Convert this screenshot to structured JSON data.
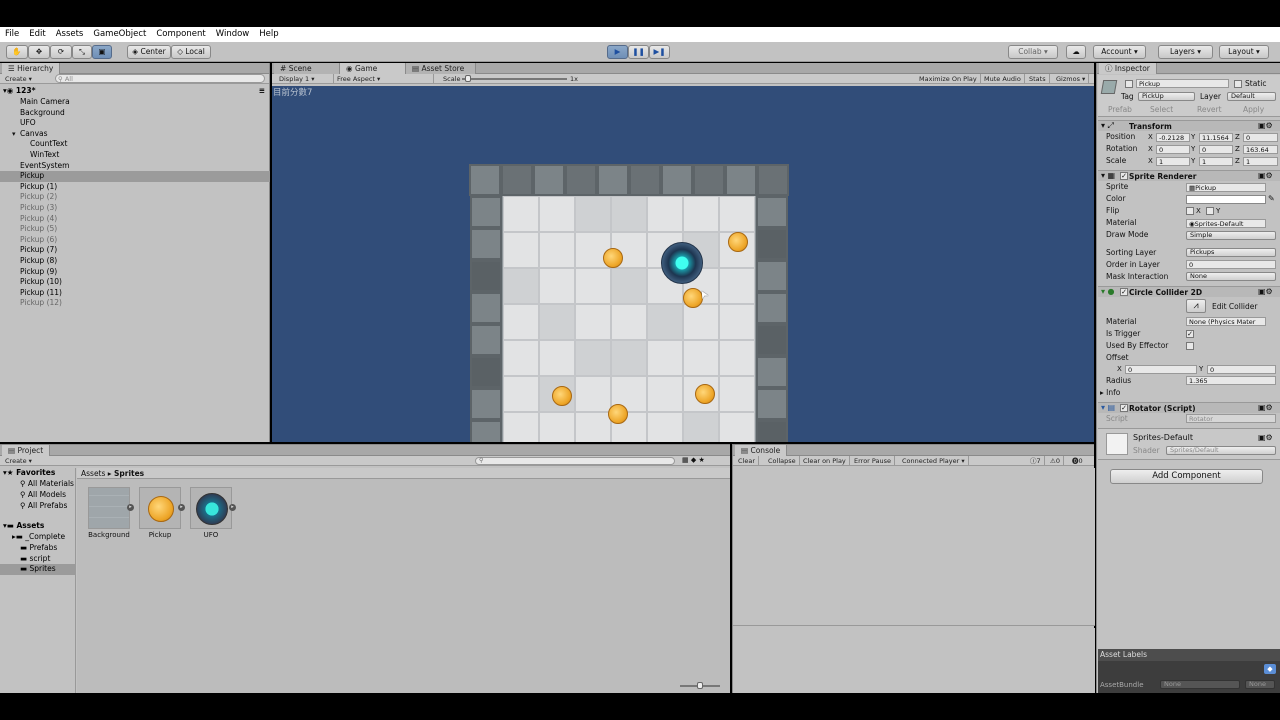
{
  "menu": [
    "File",
    "Edit",
    "Assets",
    "GameObject",
    "Component",
    "Window",
    "Help"
  ],
  "toolbar": {
    "center_label": "Center",
    "local_label": "Local",
    "collab_label": "Collab",
    "account_label": "Account",
    "layers_label": "Layers",
    "layout_label": "Layout"
  },
  "hierarchy": {
    "tab": "Hierarchy",
    "create": "Create",
    "search_placeholder": "All",
    "scene": "123*",
    "items": [
      {
        "label": "Main Camera",
        "state": "normal",
        "indent": 1
      },
      {
        "label": "Background",
        "state": "normal",
        "indent": 1
      },
      {
        "label": "UFO",
        "state": "normal",
        "indent": 1
      },
      {
        "label": "Canvas",
        "state": "normal",
        "indent": 1
      },
      {
        "label": "CountText",
        "state": "normal",
        "indent": 2
      },
      {
        "label": "WinText",
        "state": "normal",
        "indent": 2
      },
      {
        "label": "EventSystem",
        "state": "normal",
        "indent": 1
      },
      {
        "label": "Pickup",
        "state": "selected",
        "indent": 1
      },
      {
        "label": "Pickup (1)",
        "state": "normal",
        "indent": 1
      },
      {
        "label": "Pickup (2)",
        "state": "dim",
        "indent": 1
      },
      {
        "label": "Pickup (3)",
        "state": "dim",
        "indent": 1
      },
      {
        "label": "Pickup (4)",
        "state": "dim",
        "indent": 1
      },
      {
        "label": "Pickup (5)",
        "state": "dim",
        "indent": 1
      },
      {
        "label": "Pickup (6)",
        "state": "dim",
        "indent": 1
      },
      {
        "label": "Pickup (7)",
        "state": "normal",
        "indent": 1
      },
      {
        "label": "Pickup (8)",
        "state": "normal",
        "indent": 1
      },
      {
        "label": "Pickup (9)",
        "state": "normal",
        "indent": 1
      },
      {
        "label": "Pickup (10)",
        "state": "normal",
        "indent": 1
      },
      {
        "label": "Pickup (11)",
        "state": "normal",
        "indent": 1
      },
      {
        "label": "Pickup (12)",
        "state": "dim",
        "indent": 1
      }
    ]
  },
  "center_tabs": [
    "Scene",
    "Game",
    "Asset Store"
  ],
  "game_bar": {
    "display": "Display 1",
    "aspect": "Free Aspect",
    "scale_label": "Scale",
    "scale_value": "1x",
    "maximize": "Maximize On Play",
    "mute": "Mute Audio",
    "stats": "Stats",
    "gizmos": "Gizmos"
  },
  "game_view": {
    "score_text": "目前分數7",
    "bg_color": "#314d79"
  },
  "project": {
    "tab": "Project",
    "create": "Create",
    "favorites_label": "Favorites",
    "favorites": [
      "All Materials",
      "All Models",
      "All Prefabs"
    ],
    "assets_label": "Assets",
    "folders": [
      "_Complete",
      "Prefabs",
      "script",
      "Sprites"
    ],
    "breadcrumb": [
      "Assets",
      "Sprites"
    ],
    "assets": [
      "Background",
      "Pickup",
      "UFO"
    ]
  },
  "console": {
    "tab": "Console",
    "buttons": [
      "Clear",
      "Collapse",
      "Clear on Play",
      "Error Pause",
      "Connected Player"
    ],
    "counts": [
      "7",
      "0",
      "0"
    ]
  },
  "inspector": {
    "tab": "Inspector",
    "object_name": "Pickup",
    "static_label": "Static",
    "tag_label": "Tag",
    "tag_value": "PickUp",
    "layer_label": "Layer",
    "layer_value": "Default",
    "prefab_buttons": [
      "Prefab",
      "Select",
      "Revert",
      "Apply"
    ],
    "transform": {
      "title": "Transform",
      "position_label": "Position",
      "rotation_label": "Rotation",
      "scale_label": "Scale",
      "position": [
        "-0.2128",
        "11.1564",
        "0"
      ],
      "rotation": [
        "0",
        "0",
        "163.64"
      ],
      "scale": [
        "1",
        "1",
        "1"
      ]
    },
    "sprite_renderer": {
      "title": "Sprite Renderer",
      "sprite_label": "Sprite",
      "sprite": "Pickup",
      "color_label": "Color",
      "flip_label": "Flip",
      "material_label": "Material",
      "material": "Sprites-Default",
      "draw_mode_label": "Draw Mode",
      "draw_mode": "Simple",
      "sorting_layer_label": "Sorting Layer",
      "sorting_layer": "Pickups",
      "order_label": "Order in Layer",
      "order": "0",
      "mask_label": "Mask Interaction",
      "mask": "None"
    },
    "collider": {
      "title": "Circle Collider 2D",
      "edit_label": "Edit Collider",
      "material_label": "Material",
      "material": "None (Physics Mater",
      "trigger_label": "Is Trigger",
      "effector_label": "Used By Effector",
      "offset_label": "Offset",
      "offset": [
        "0",
        "0"
      ],
      "radius_label": "Radius",
      "radius": "1.365",
      "info_label": "Info"
    },
    "rotator": {
      "title": "Rotator (Script)",
      "script_label": "Script",
      "script": "Rotator"
    },
    "material_preview": {
      "name": "Sprites-Default",
      "shader_label": "Shader",
      "shader": "Sprites/Default"
    },
    "add_component": "Add Component",
    "asset_labels": "Asset Labels",
    "asset_bundle_label": "AssetBundle",
    "asset_bundle": [
      "None",
      "None"
    ]
  }
}
